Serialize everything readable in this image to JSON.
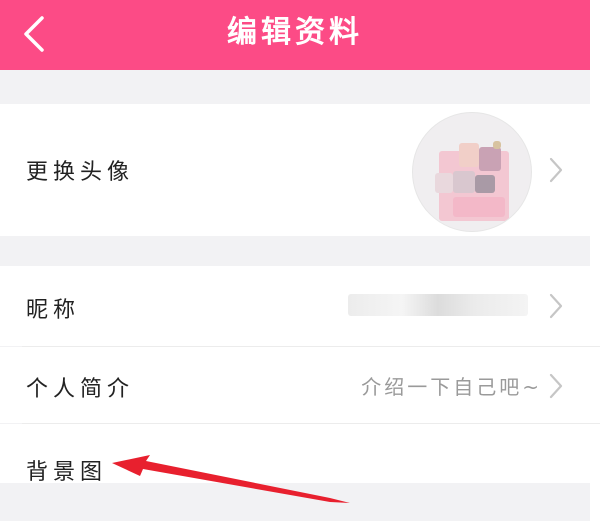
{
  "header": {
    "title": "编辑资料",
    "background": "#fc4b86"
  },
  "rows": {
    "avatar": {
      "label": "更换头像"
    },
    "nickname": {
      "label": "昵称"
    },
    "bio": {
      "label": "个人简介",
      "placeholder": "介绍一下自己吧~"
    },
    "background": {
      "label": "背景图"
    }
  },
  "icons": {
    "back": "chevron-left-icon",
    "row": "chevron-right-icon"
  },
  "annotation_color": "#e8202e"
}
